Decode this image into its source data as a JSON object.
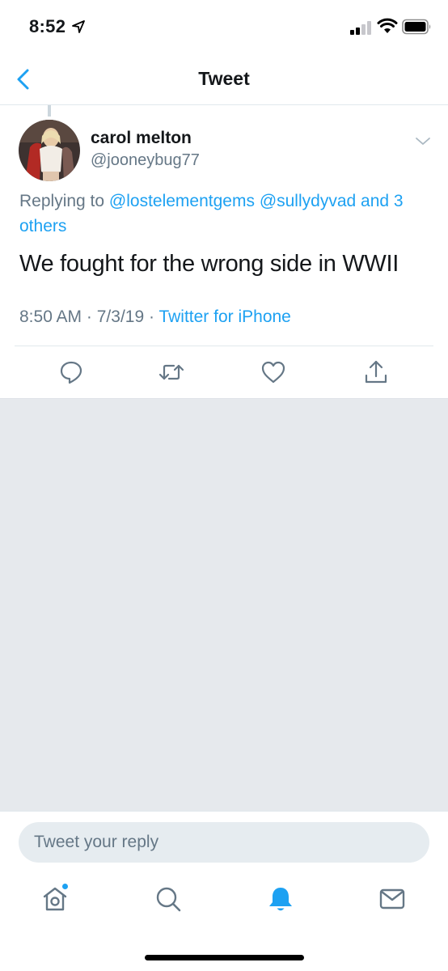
{
  "status_bar": {
    "time": "8:52",
    "icons": [
      "location-arrow-icon",
      "cellular-signal-icon",
      "wifi-icon",
      "battery-icon"
    ]
  },
  "nav": {
    "title": "Tweet",
    "back_icon": "chevron-left-icon"
  },
  "tweet": {
    "author_name": "carol melton",
    "author_handle": "@jooneybug77",
    "replying_prefix": "Replying to",
    "replying_mentions": [
      "@lostelementgems",
      "@sullydyvad"
    ],
    "replying_and": "and",
    "replying_others": "3 others",
    "text": "We fought for the wrong side in WWII",
    "time": "8:50 AM",
    "separator": "·",
    "date": "7/3/19",
    "source": "Twitter for iPhone"
  },
  "actions": [
    "reply-icon",
    "retweet-icon",
    "like-icon",
    "share-icon"
  ],
  "reply": {
    "placeholder": "Tweet your reply"
  },
  "tab_bar": [
    "home-icon",
    "search-icon",
    "notifications-icon",
    "messages-icon"
  ],
  "colors": {
    "accent": "#1da1f2",
    "text": "#14171a",
    "secondary": "#657786",
    "background_gray": "#e6e9ed"
  }
}
